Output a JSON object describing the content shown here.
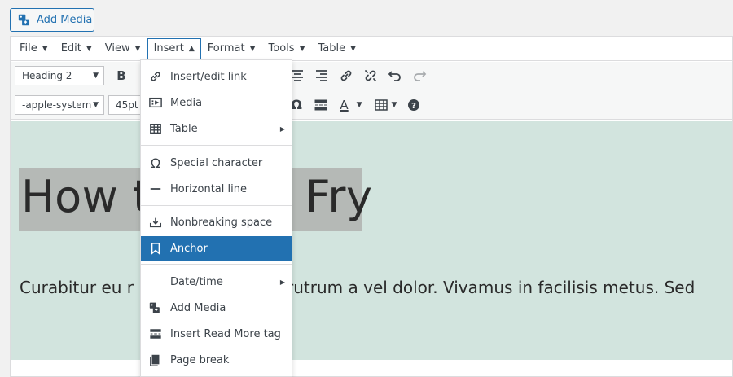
{
  "add_media_button": {
    "label": "Add Media"
  },
  "menubar": {
    "items": [
      {
        "label": "File"
      },
      {
        "label": "Edit"
      },
      {
        "label": "View"
      },
      {
        "label": "Insert"
      },
      {
        "label": "Format"
      },
      {
        "label": "Tools"
      },
      {
        "label": "Table"
      }
    ],
    "active": "Insert"
  },
  "toolbar": {
    "block_format": "Heading 2",
    "font_family": "-apple-system",
    "font_size": "45pt",
    "bold_label": "B"
  },
  "insert_menu": {
    "items": [
      {
        "label": "Insert/edit link",
        "icon": "link-icon"
      },
      {
        "label": "Media",
        "icon": "media-icon"
      },
      {
        "label": "Table",
        "icon": "table-icon",
        "submenu": true
      },
      {
        "label": "Special character",
        "icon": "omega-icon"
      },
      {
        "label": "Horizontal line",
        "icon": "horizontal-line-icon"
      },
      {
        "label": "Nonbreaking space",
        "icon": "nonbreaking-space-icon"
      },
      {
        "label": "Anchor",
        "icon": "bookmark-icon",
        "selected": true
      },
      {
        "label": "Date/time",
        "icon": "",
        "submenu": true
      },
      {
        "label": "Add Media",
        "icon": "add-media-icon"
      },
      {
        "label": "Insert Read More tag",
        "icon": "read-more-icon"
      },
      {
        "label": "Page break",
        "icon": "page-break-icon"
      }
    ]
  },
  "content": {
    "heading_visible_left": "How t",
    "heading_visible_right": "Fry",
    "paragraph_left": "Curabitur eu r",
    "paragraph_right": "rutrum a vel dolor. Vivamus in facilisis metus. Sed"
  },
  "colors": {
    "accent": "#2271b1",
    "content_bg": "#d2e4de",
    "heading_highlight": "#b5b9b6"
  }
}
